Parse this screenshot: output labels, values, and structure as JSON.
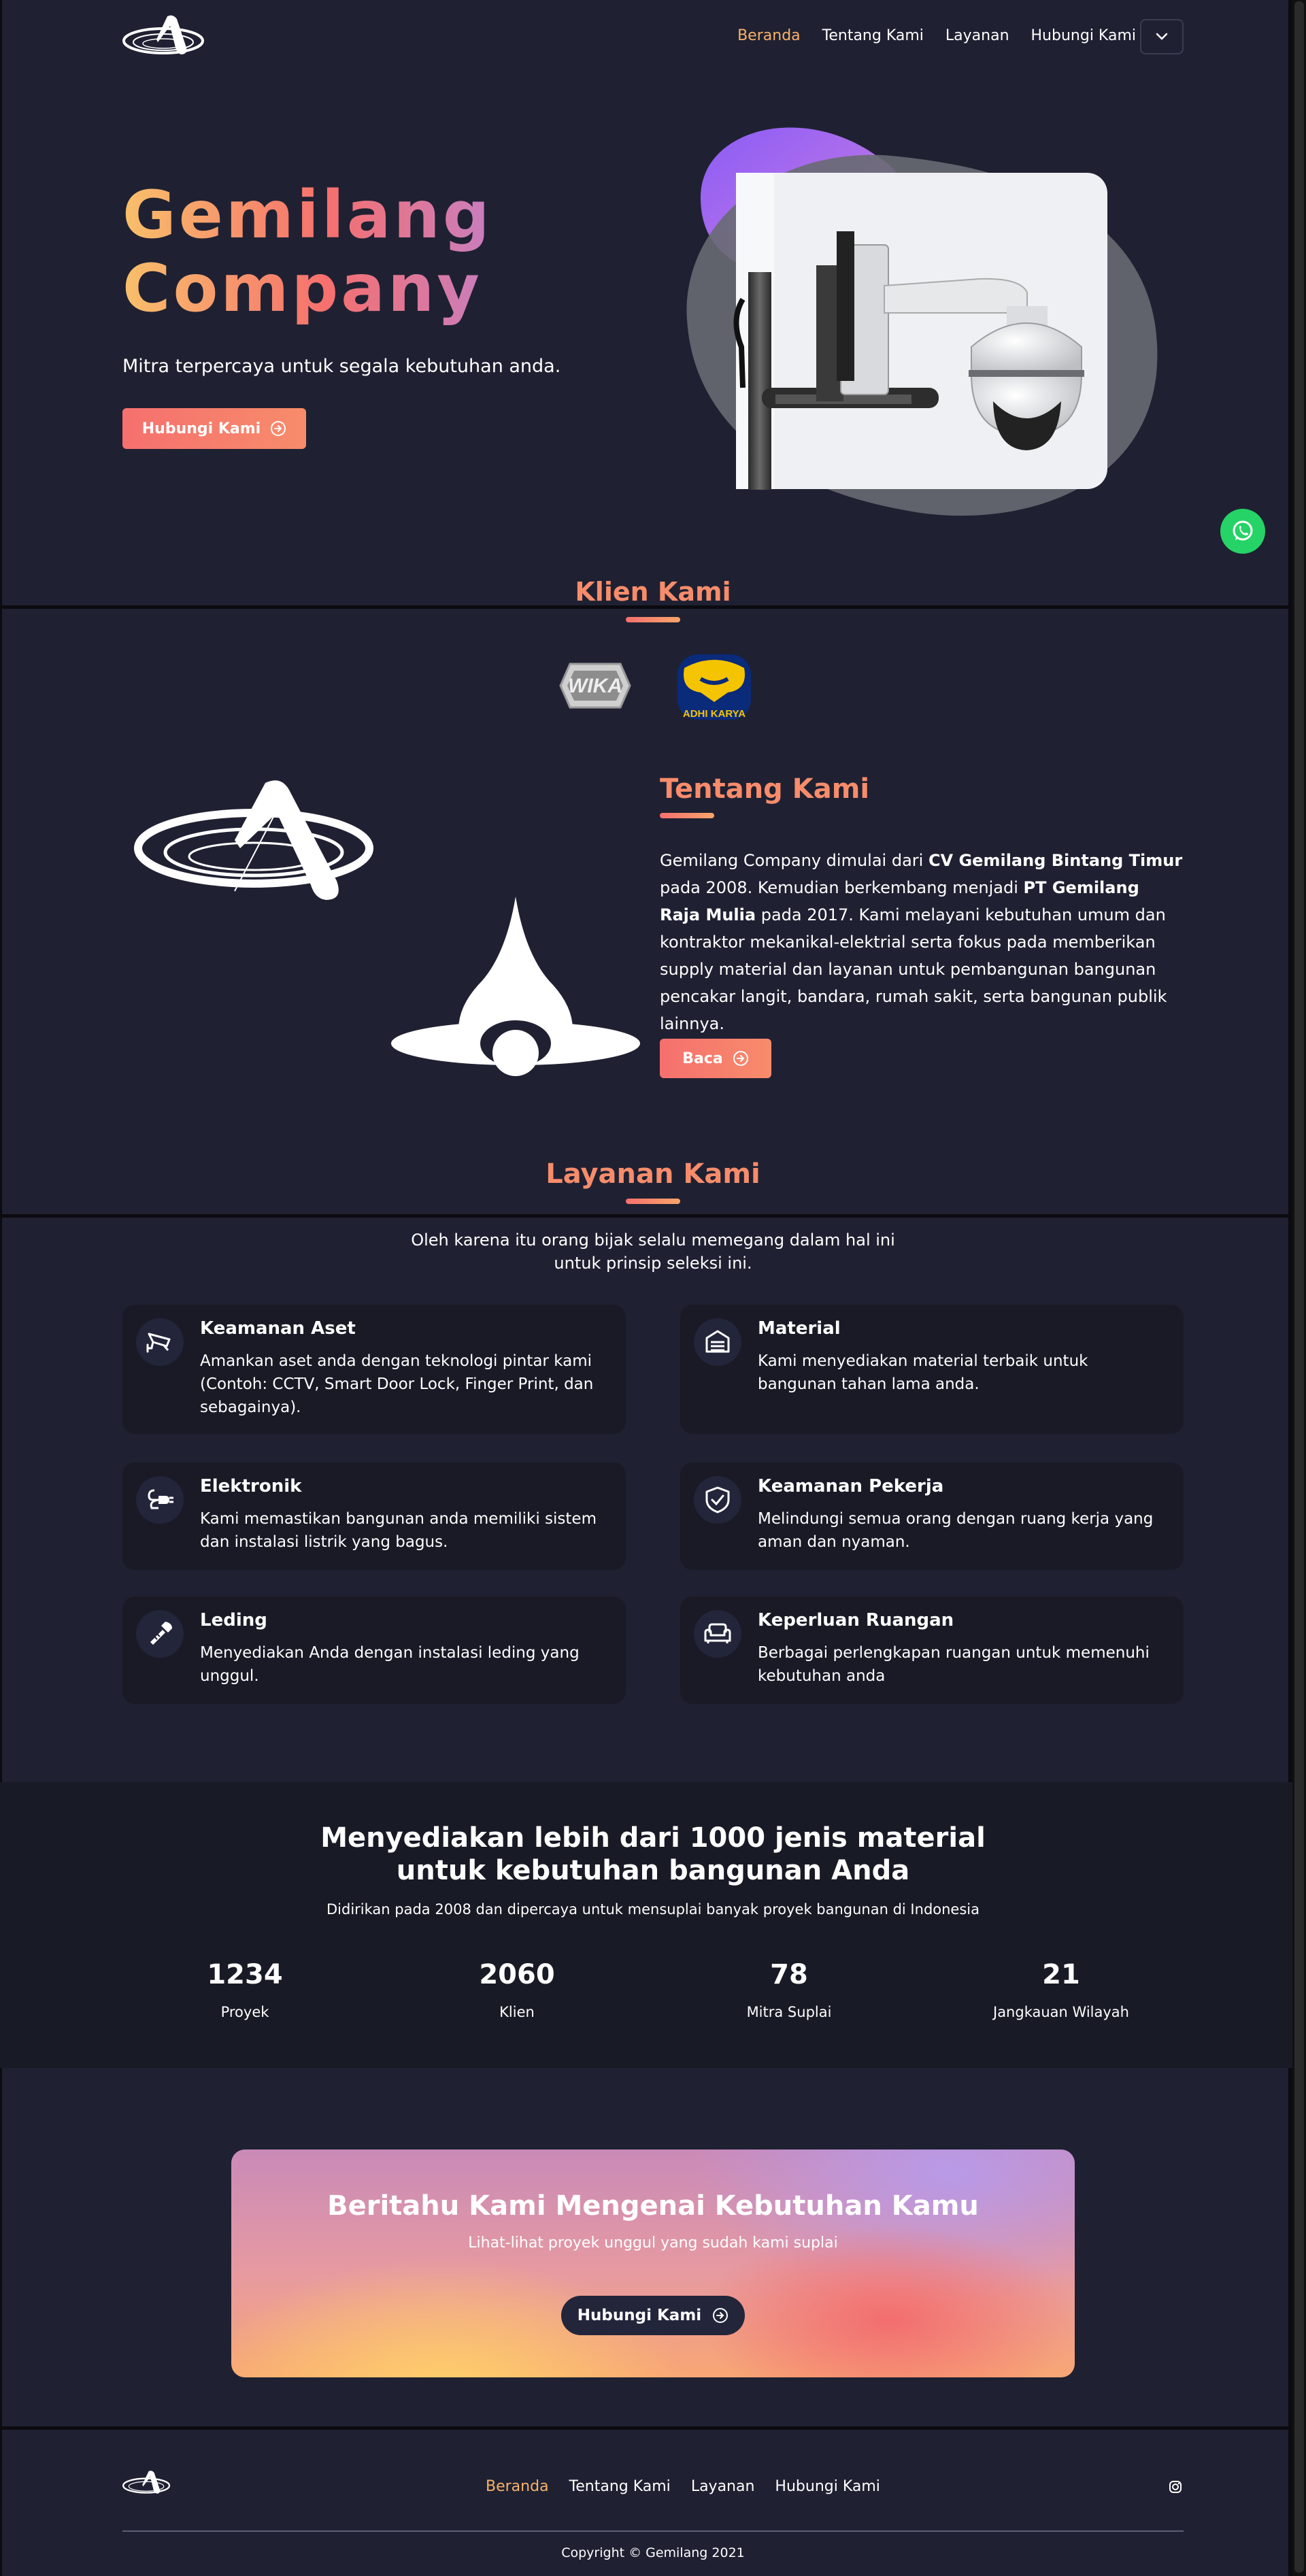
{
  "colors": {
    "accent": "#f78c6b",
    "active_link": "#f8b26a",
    "background": "#1f2132",
    "card": "#191a26",
    "whatsapp": "#25d366"
  },
  "nav": {
    "links": [
      "Beranda",
      "Tentang Kami",
      "Layanan",
      "Hubungi Kami"
    ],
    "active_link": "Beranda",
    "toggle_icon": "chevron-down-icon"
  },
  "hero": {
    "title_line1": "Gemilang",
    "title_line2": "Company",
    "subtitle": "Mitra terpercaya untuk segala kebutuhan anda.",
    "button_label": "Hubungi Kami",
    "image": "cctv-camera"
  },
  "clients": {
    "title": "Klien Kami",
    "logos": [
      "WIKA",
      "ADHI KARYA"
    ]
  },
  "about": {
    "title": "Tentang Kami",
    "text_1": "Gemilang Company dimulai dari ",
    "bold_1": "CV Gemilang Bintang Timur",
    "text_2": " pada 2008. Kemudian berkembang menjadi ",
    "bold_2": "PT Gemilang Raja Mulia",
    "text_3": " pada 2017. Kami melayani kebutuhan umum dan kontraktor mekanikal-elektrial serta fokus pada memberikan supply material dan layanan untuk pembangunan bangunan pencakar langit, bandara, rumah sakit, serta bangunan publik lainnya.",
    "button_label": "Baca"
  },
  "services": {
    "title": "Layanan Kami",
    "intro_line1": "Oleh karena itu orang bijak selalu memegang dalam hal ini",
    "intro_line2": "untuk prinsip seleksi ini.",
    "items": [
      {
        "icon": "cctv-icon",
        "title": "Keamanan Aset",
        "desc": "Amankan aset anda dengan teknologi pintar kami (Contoh: CCTV, Smart Door Lock, Finger Print, dan sebagainya)."
      },
      {
        "icon": "warehouse-icon",
        "title": "Material",
        "desc": "Kami menyediakan material terbaik untuk bangunan tahan lama anda."
      },
      {
        "icon": "plug-icon",
        "title": "Elektronik",
        "desc": "Kami memastikan bangunan anda memiliki sistem dan instalasi listrik yang bagus."
      },
      {
        "icon": "shield-check-icon",
        "title": "Keamanan Pekerja",
        "desc": "Melindungi semua orang dengan ruang kerja yang aman dan nyaman."
      },
      {
        "icon": "wrench-icon",
        "title": "Leding",
        "desc": "Menyediakan Anda dengan instalasi leding yang unggul."
      },
      {
        "icon": "sofa-icon",
        "title": "Keperluan Ruangan",
        "desc": "Berbagai perlengkapan ruangan untuk memenuhi kebutuhan anda"
      }
    ]
  },
  "stats": {
    "title_line1": "Menyediakan lebih dari 1000 jenis material",
    "title_line2": "untuk kebutuhan bangunan Anda",
    "subtitle": "Didirikan pada 2008 dan dipercaya untuk mensuplai banyak proyek bangunan di Indonesia",
    "items": [
      {
        "value": "1234",
        "label": "Proyek"
      },
      {
        "value": "2060",
        "label": "Klien"
      },
      {
        "value": "78",
        "label": "Mitra Suplai"
      },
      {
        "value": "21",
        "label": "Jangkauan Wilayah"
      }
    ]
  },
  "cta": {
    "title": "Beritahu Kami Mengenai Kebutuhan Kamu",
    "subtitle": "Lihat-lihat proyek unggul yang sudah kami suplai",
    "button_label": "Hubungi Kami"
  },
  "footer": {
    "links": [
      "Beranda",
      "Tentang Kami",
      "Layanan",
      "Hubungi Kami"
    ],
    "active_link": "Beranda",
    "social_icon": "instagram-icon",
    "copyright": "Copyright © Gemilang 2021"
  }
}
